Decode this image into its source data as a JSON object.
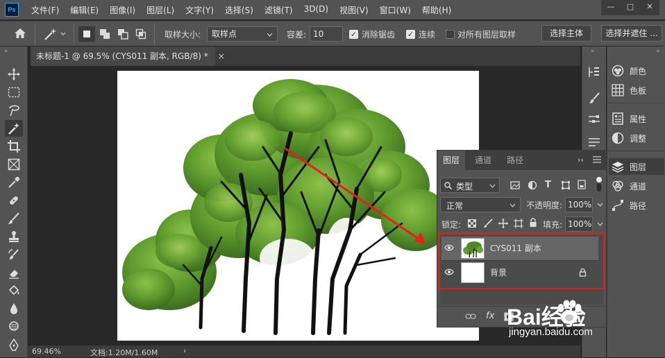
{
  "menubar": {
    "logo": "Ps",
    "items": [
      "文件(F)",
      "编辑(E)",
      "图像(I)",
      "图层(L)",
      "文字(Y)",
      "选择(S)",
      "滤镜(T)",
      "3D(D)",
      "视图(V)",
      "窗口(W)",
      "帮助(H)"
    ],
    "window_controls": [
      "—",
      "□",
      "✕"
    ]
  },
  "options": {
    "sample_size_label": "取样大小:",
    "sample_size_value": "取样点",
    "tolerance_label": "容差:",
    "tolerance_value": "10",
    "antialias_label": "消除锯齿",
    "antialias_checked": true,
    "contiguous_label": "连续",
    "contiguous_checked": true,
    "all_layers_label": "对所有图层取样",
    "all_layers_checked": false,
    "select_subject": "选择主体",
    "select_mask": "选择并遮住 ..."
  },
  "document": {
    "tab_title": "未标题-1 @ 69.5% (CYS011 副本, RGB/8) *",
    "tab_close": "×"
  },
  "status": {
    "zoom": "69.46%",
    "doc_info": "文档:1.20M/1.60M",
    "arrow": "›"
  },
  "right_panels": [
    {
      "label": "颜色",
      "icon": "color-wheel-icon"
    },
    {
      "label": "色板",
      "icon": "swatches-grid-icon"
    },
    {
      "label": "属性",
      "icon": "properties-icon"
    },
    {
      "label": "调整",
      "icon": "adjustments-icon"
    },
    {
      "label": "图层",
      "icon": "layers-stack-icon"
    },
    {
      "label": "通道",
      "icon": "channels-icon"
    },
    {
      "label": "路径",
      "icon": "paths-icon"
    }
  ],
  "layers_panel": {
    "tabs": [
      "图层",
      "通道",
      "路径"
    ],
    "filter_type": "类型",
    "blend_mode": "正常",
    "opacity_label": "不透明度:",
    "opacity_value": "100%",
    "lock_label": "锁定:",
    "fill_label": "填充:",
    "fill_value": "100%",
    "collapse_glyph": "››",
    "footer_fx": "fx",
    "layers": [
      {
        "name": "CYS011 副本",
        "visible": true,
        "selected": true,
        "locked": false
      },
      {
        "name": "背景",
        "visible": true,
        "selected": false,
        "locked": true
      }
    ]
  },
  "colors": {
    "highlight_box": "#e0201a",
    "annotation_arrow": "#e8201c"
  },
  "watermark": {
    "brand": "Bai经验",
    "url": "jingyan.baidu.com"
  }
}
